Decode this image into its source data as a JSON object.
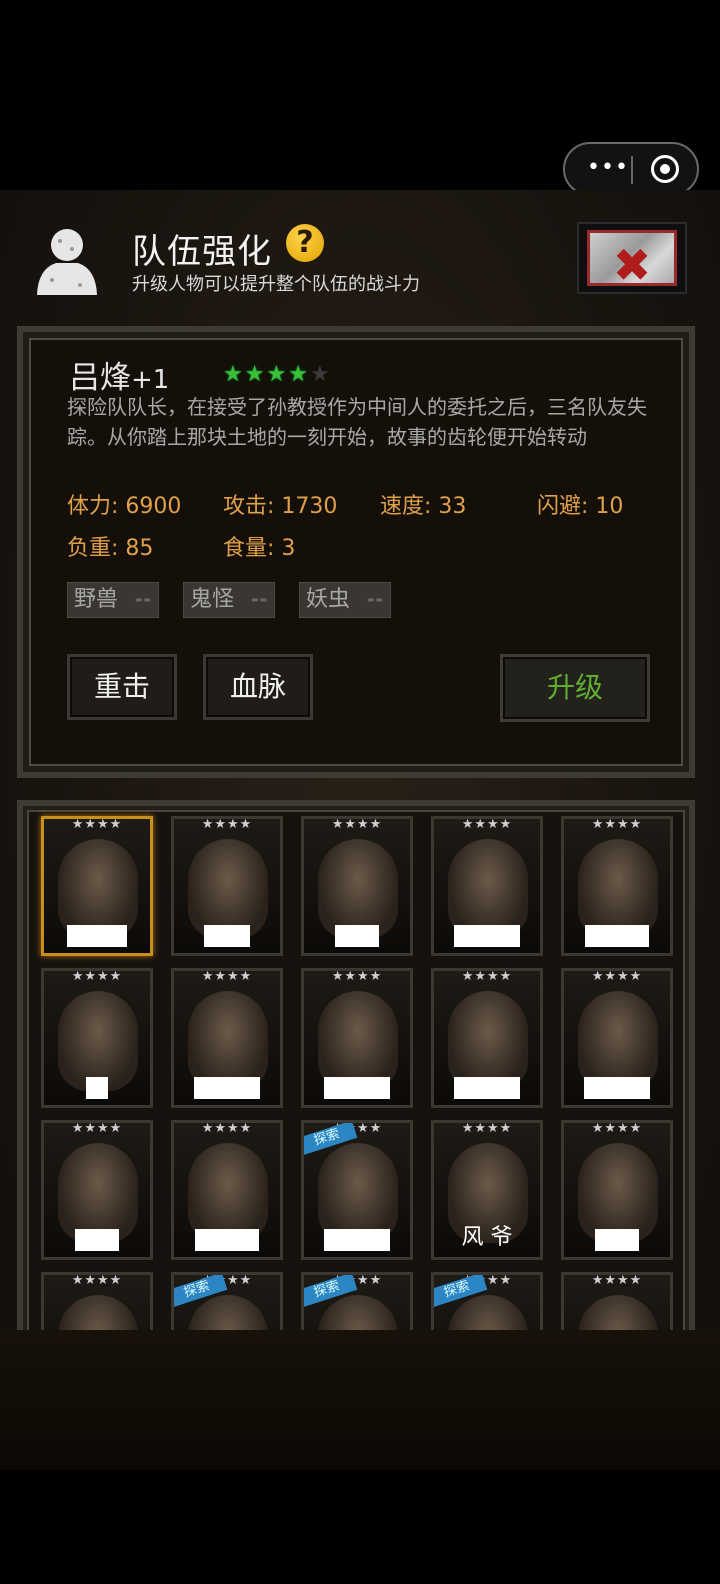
{
  "top_capsule": {
    "menu_icon": "more-dots-icon",
    "close_icon": "target-circle-icon"
  },
  "header": {
    "title": "队伍强化",
    "help": "?",
    "subtitle": "升级人物可以提升整个队伍的战斗力",
    "close_icon": "close-x-icon"
  },
  "hero": {
    "name": "吕烽",
    "level": "+1",
    "stars_filled": 4,
    "stars_total": 5,
    "description": "探险队队长，在接受了孙教授作为中间人的委托之后，三名队友失踪。从你踏上那块土地的一刻开始，故事的齿轮便开始转动",
    "stats": {
      "hp": "体力: 6900",
      "attack": "攻击: 1730",
      "speed": "速度: 33",
      "dodge": "闪避: 10",
      "load": "负重: 85",
      "food": "食量: 3"
    },
    "tags": [
      "野兽",
      "鬼怪",
      "妖虫"
    ],
    "buttons": {
      "skill1": "重击",
      "skill2": "血脉",
      "upgrade": "升级"
    }
  },
  "roster": {
    "star_text": "★★★★",
    "badge_text": "探索",
    "visible_name": "风 爷",
    "selected_index": 0,
    "explore_badges": [
      12,
      16,
      17,
      18
    ]
  }
}
